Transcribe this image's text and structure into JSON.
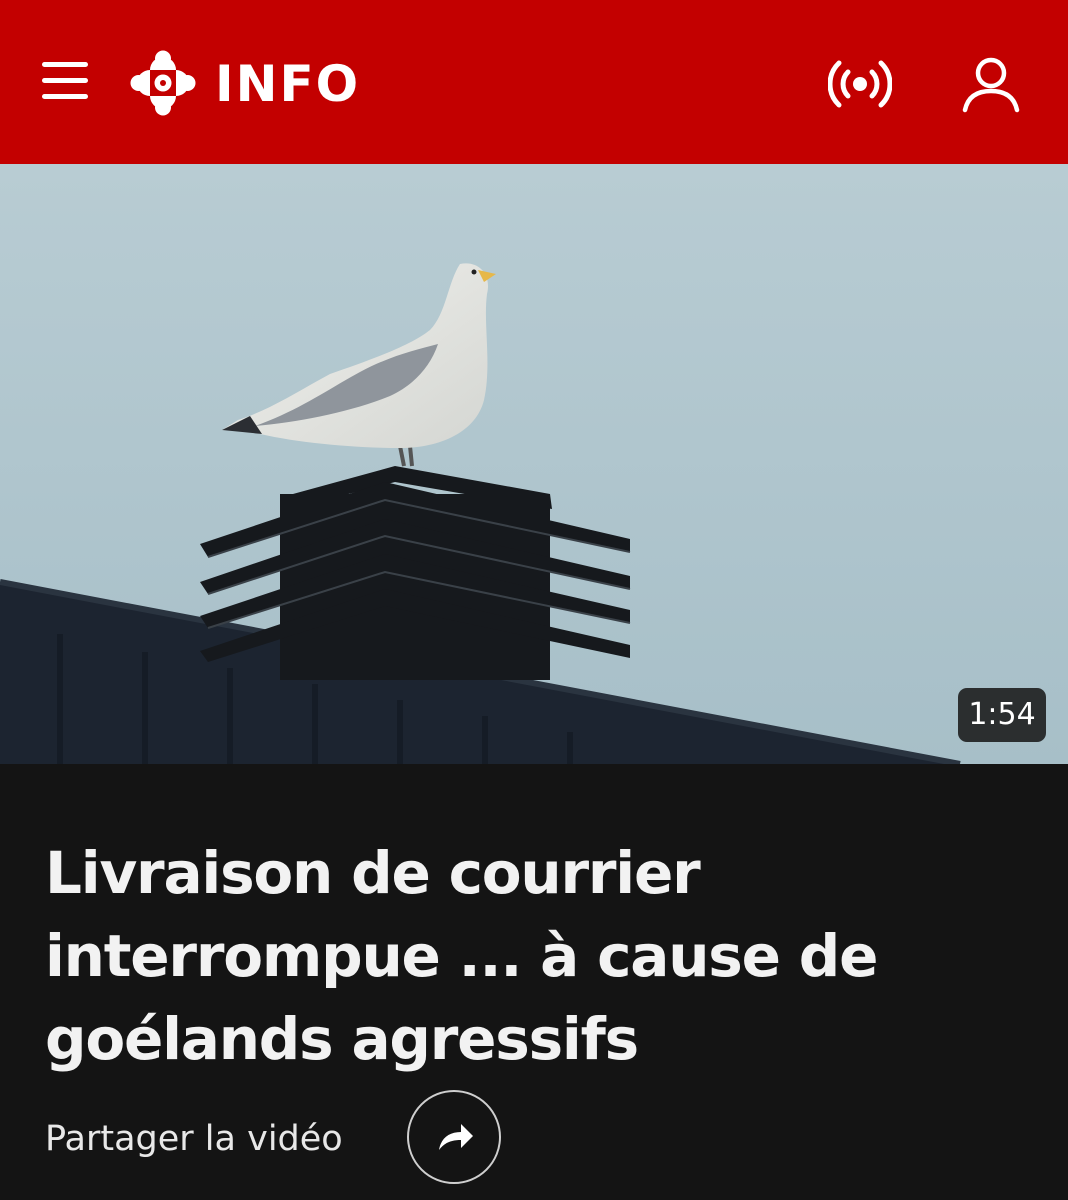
{
  "header": {
    "brand": "INFO",
    "background_color": "#c30000",
    "icons": [
      "menu-icon",
      "cbc-gem-logo",
      "live-radio-icon",
      "user-icon"
    ]
  },
  "video": {
    "duration": "1:54"
  },
  "article": {
    "title": "Livraison de courrier interrompue ... à cause de goélands agressifs",
    "share_label": "Partager la vidéo"
  }
}
